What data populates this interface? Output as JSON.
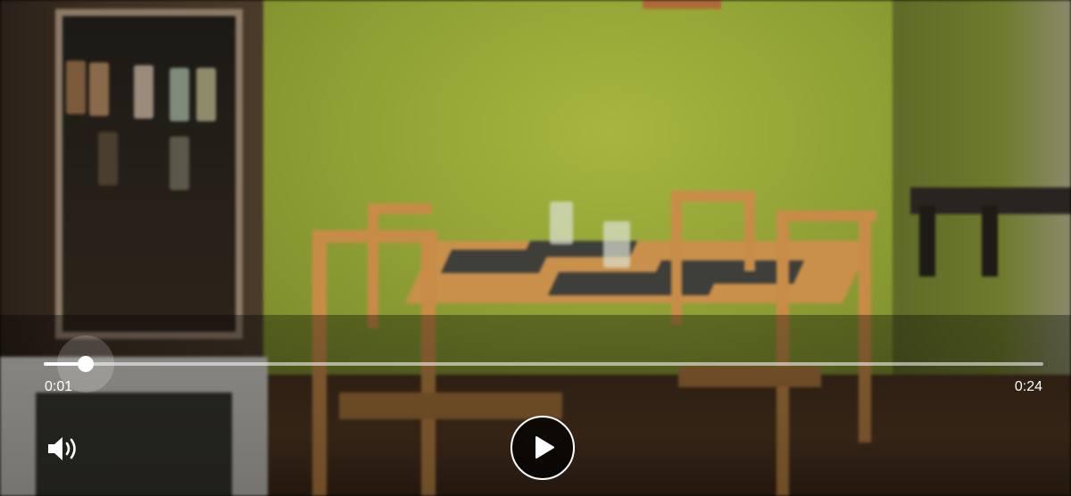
{
  "player": {
    "elapsed_time": "0:01",
    "total_time": "0:24",
    "progress_fraction": 0.042,
    "accent_color": "#ffffff"
  },
  "controls": {
    "volume_icon": "speaker-volume-icon",
    "play_icon": "play-icon"
  },
  "video": {
    "scene": "dining-room-frame"
  }
}
